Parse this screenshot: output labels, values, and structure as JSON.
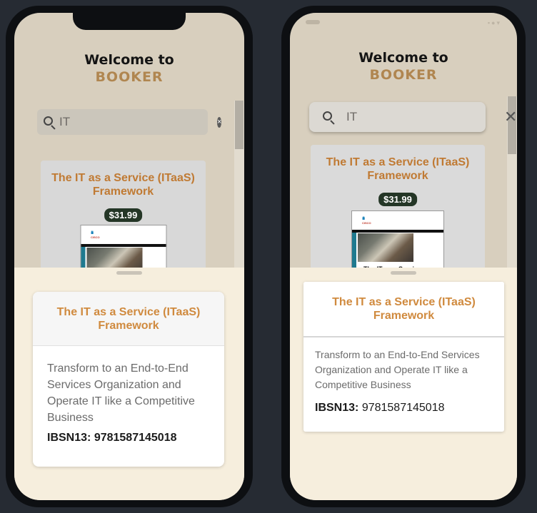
{
  "screens": [
    {
      "welcome": "Welcome to",
      "brand": "BOOKER",
      "search": {
        "value": "IT",
        "clear_icon": "×"
      },
      "book": {
        "title": "The IT as a Service (ITaaS) Framework",
        "price": "$31.99",
        "cover_logo": "CISCO"
      },
      "detail": {
        "title": "The IT as a Service (ITaaS) Framework",
        "description": "Transform to an End-to-End Services Organization and Operate IT like a Competitive Business",
        "isbn_label": "IBSN13:",
        "isbn_value": "9781587145018"
      }
    },
    {
      "welcome": "Welcome to",
      "brand": "BOOKER",
      "search": {
        "value": "IT",
        "clear_icon": "✕"
      },
      "book": {
        "title": "The IT as a Service (ITaaS) Framework",
        "price": "$31.99",
        "cover_logo": "CISCO",
        "cover_title": "The IT as a Service"
      },
      "detail": {
        "title": "The IT as a Service (ITaaS) Framework",
        "description": "Transform to an End-to-End Services Organization and Operate IT like a Competitive Business",
        "isbn_label": "IBSN13:",
        "isbn_value": "9781587145018"
      },
      "status_icons": "▪●▾"
    }
  ],
  "icons": {
    "search": "search-icon",
    "clear": "clear-icon",
    "sheet_handle": "drag-handle-icon"
  },
  "colors": {
    "background": "#262b33",
    "screen": "#d8cfbe",
    "sheet": "#f6eedd",
    "brand": "#b08650",
    "accent_title": "#c07a33",
    "price_badge": "#243626"
  }
}
